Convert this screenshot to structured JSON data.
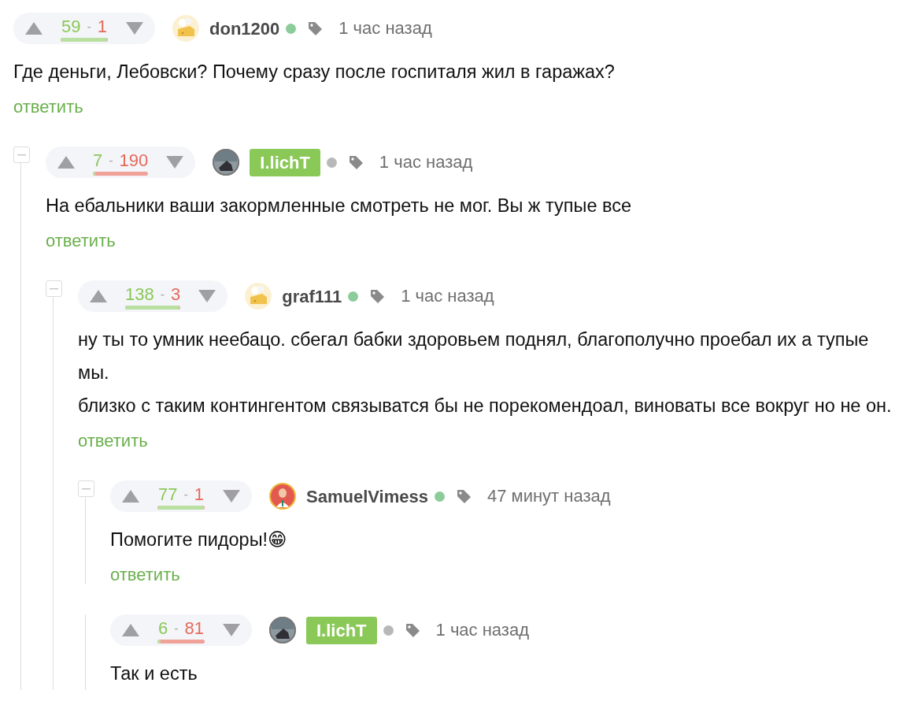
{
  "comments": [
    {
      "rating": {
        "plus": "59",
        "dash": "-",
        "minus": "1",
        "level": 0.98
      },
      "user": "don1200",
      "highlighted": false,
      "online": true,
      "time": "1 час назад",
      "collapse_button": false,
      "paragraphs": [
        "Где деньги, Лебовски? Почему сразу после госпиталя жил в гаражах?"
      ],
      "reply": "ответить",
      "children": [
        {
          "rating": {
            "plus": "7",
            "dash": "-",
            "minus": "190",
            "level": 0.04
          },
          "user": "I.lichT",
          "highlighted": true,
          "online": false,
          "time": "1 час назад",
          "collapse_button": true,
          "paragraphs": [
            "На ебальники ваши закормленные смотреть не мог. Вы ж тупые все"
          ],
          "reply": "ответить",
          "children": [
            {
              "rating": {
                "plus": "138",
                "dash": "-",
                "minus": "3",
                "level": 0.98
              },
              "user": "graf111",
              "highlighted": false,
              "online": true,
              "time": "1 час назад",
              "collapse_button": true,
              "paragraphs": [
                "ну ты то умник неебацо. сбегал бабки здоровьем поднял, благополучно проебал их а тупые мы.",
                "близко с таким контингентом связыватся бы не порекомендоал, виноваты все вокруг но не он."
              ],
              "reply": "ответить",
              "children": [
                {
                  "rating": {
                    "plus": "77",
                    "dash": "-",
                    "minus": "1",
                    "level": 0.98
                  },
                  "user": "SamuelVimess",
                  "highlighted": false,
                  "online": true,
                  "time": "47 минут назад",
                  "collapse_button": true,
                  "paragraphs": [
                    "Помогите пидоры!😁"
                  ],
                  "reply": "ответить"
                },
                {
                  "rating": {
                    "plus": "6",
                    "dash": "-",
                    "minus": "81",
                    "level": 0.07
                  },
                  "user": "I.lichT",
                  "highlighted": true,
                  "online": false,
                  "time": "1 час назад",
                  "collapse_button": false,
                  "paragraphs": [
                    "Так и есть"
                  ]
                }
              ]
            }
          ]
        }
      ]
    }
  ]
}
